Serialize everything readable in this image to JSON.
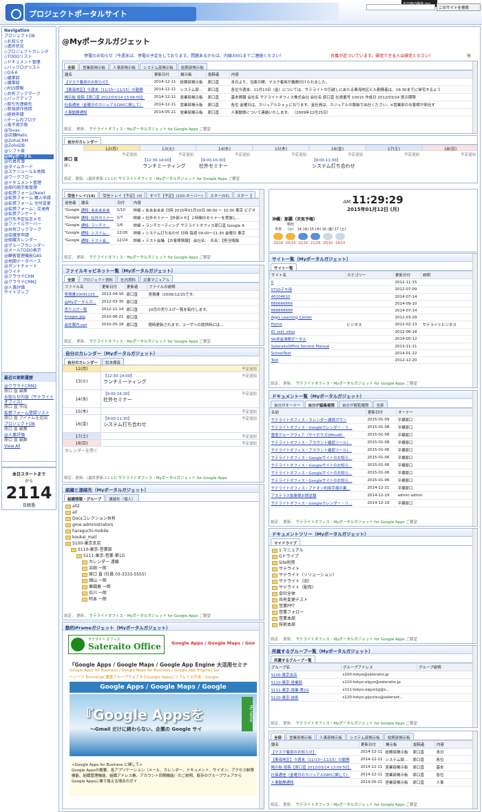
{
  "header": {
    "site_title": "プロジェクトポータルサイト",
    "topbar_label": "その他の操作 (m)",
    "search_button": "このサイトを検索"
  },
  "nav": {
    "title": "Navigation",
    "items": [
      "プロジェクトDB",
      "◇お知らせ",
      "◇進捗状況",
      "◇プロジェクトカレンダ",
      "◇TODOリスト",
      "◇ドキュメント管理",
      "◇バックログリスト",
      "◇Q＆A",
      "◇議事録",
      "◇議事録",
      "◇RSS情報",
      "◇共有ブックマーク",
      "◇バックアップ",
      "◇取引先連絡先",
      "◇新規部作他回",
      "◇経費申請",
      "◇チーム内ブログ",
      "◇電子掲示板",
      "@Tovas",
      "@店舗Matic",
      "@ZohoCRM",
      "@ZohoDB",
      "@シフト表",
      "@Myポータル",
      "@社員名簿",
      "@タイムカード",
      "@スケジュール＆地図",
      "@ワークフロー",
      "@ドキュメント管理",
      "@部内掲示板管理",
      "@拡張フォーム(New)",
      "@拡張フォーム 購入申請",
      "@拡張フォーム 住所変更",
      "@拡張フォーム：交通費",
      "@拡張アンケート",
      "@行先予定伝言メモ",
      "@ファイルサーバー",
      "@共有ブックマーク",
      "@会議室申請",
      "@組織カレンダー",
      "@グループカレンダー",
      "@メールTODO表示",
      "@顧客管理機能GAS",
      "@地図データベース",
      "@ガントチャート",
      "@ワイド",
      "@クラウドCRM",
      "@クラウドCRM2",
      "@人事評価",
      "サイトマップ"
    ],
    "active_index": 23
  },
  "recent": {
    "title": "最近の更新履歴",
    "items": [
      {
        "link": "@クラウドCRM2",
        "sub": "原口 直 編集"
      },
      {
        "link": "お知らせ内容（サテライトオフィス）",
        "sub": "原口 直 作成"
      },
      {
        "link": "拡張フォーム登録リスト",
        "sub": "原口 直 アイテムを追加"
      },
      {
        "link": "プロジェクトDB",
        "sub": "原口 直 編集"
      },
      {
        "link": "@人事評価",
        "sub": "原口 直 編集"
      }
    ],
    "view_all": "View All"
  },
  "counter": {
    "line1": "本日スタートまで",
    "line2": "から",
    "number": "2114",
    "unit": "日経過"
  },
  "page": {
    "title": "@Myポータルガジェット",
    "notice": "停電のお知らせ（今週末は、停電の予定をしております。問題あるかたは、内線3001までご連絡ください！",
    "notice_red": "台風が近づいています。帰宅できる人は帰宅ください！",
    "notice_green": "毎"
  },
  "footer": {
    "settings": "設定．",
    "more": "更新．",
    "brand": "サテライトオフィス・Myポータルガジェット for Google Apps",
    "feedback": "ご要望"
  },
  "board": {
    "tabs": [
      "全部",
      "営業部掲示板",
      "人事部掲示板",
      "システム部掲示板",
      "総務部掲示板"
    ],
    "cols": [
      "題名",
      "更新日付",
      "掲示板",
      "投稿者",
      "内容"
    ],
    "rows": [
      [
        "【マスク着用のお知らせ】",
        "2014-12-11",
        "総務部掲示板",
        "原口直",
        "本日より、当面の間、マスク着用が義務付けられました。"
      ],
      [
        "【東海地区】今週末（11/15～11/15）の勤務",
        "2014-12-11",
        "システム部...",
        "原口直",
        "各位今週末、11月13日（金）については、サテライトの引越しにあたる東海地区ビル勤務者は、19:30までに帰宅するよう"
      ],
      [
        "掲示板 投稿【原口直 2012/03/14 13:09:50】",
        "2014-12-11",
        "営業部掲示板",
        "原口直",
        "基本情報 会社名 サテライトオフィス株式会社 会社名 原口直 社員番号 10015 作成日 2012/03/14 提示期限"
      ],
      [
        "社長通信（金曜日のカジュアルDAYに関して）",
        "2014-12-11",
        "営業部掲示板",
        "原口直",
        "各位 金曜日は、カジュアルＤａｙになります。金社員は、カジュアルの服装で出社ください。※営業部のお客様が来社す"
      ],
      [
        "人事動静通知",
        "2014-05-21",
        "営業部掲示板",
        "原口直",
        "人事動態について連絡いたします。 （2009年12月25日）"
      ]
    ]
  },
  "calendar_week": {
    "title": "自分のカレンダー",
    "days": [
      "12(月)",
      "13(火)",
      "14(水)",
      "15(木)",
      "16(金)",
      "17(土)",
      "18(日)"
    ],
    "person": "原口 直",
    "add": "予定追加",
    "events": [
      {
        "day": 1,
        "time": "【12:30-14:00】",
        "name": "ランチミーティング"
      },
      {
        "day": 2,
        "time": "【9:00-16:30】",
        "name": "社外セミナー"
      },
      {
        "day": 4,
        "time": "【9:00-11:30】",
        "name": "システム打ち合わせ"
      }
    ],
    "close": "閉く",
    "footer": "設定．更新．(最終更新:11:13)"
  },
  "mail": {
    "tabs": [
      "受信トレイ(14)",
      "受信トレイ【予定】(4)",
      "すべて【予定】(100-オーバー)",
      "スター(55)",
      "スター【"
    ],
    "cols": [
      "送信者",
      "題名",
      "日付",
      "内容"
    ],
    "rows": [
      [
        "\"Google...",
        "通知: あああああ",
        "1/10",
        "詳細 » あああああ 日時 2015年01月10日 06:00 ～ 10:30 東京 ビデオ"
      ],
      [
        "\"Google...",
        "通知: 社外セミナー",
        "1/7",
        "詳細 » 社外セミナー【外部メモ】２時間のセミナーを実施し..."
      ],
      [
        "\"Google...",
        "通知: ランチミ...",
        "1/6",
        "詳細 » ランチミーティング サテライトオフィス原口直 Google A"
      ],
      [
        "\"Google...",
        "通知: システム...",
        "12/26",
        "詳細 » システム打ち合わせ 日時 毎週 09:00～11:30 金曜日 東京"
      ],
      [
        "\"Google...",
        "通知: テスト会...",
        "12/24",
        "詳細 » テスト会議 【お客様情報】 会社名：　氏名：【担当情報"
      ]
    ]
  },
  "clock": {
    "ampm": "AM",
    "time": "11:29:29",
    "date": "2015年01月12日 (月)",
    "weather_title": "沖縄：那覇（天気予報）",
    "forecast": [
      [
        "今日",
        "19|16"
      ],
      [
        "明日（火）",
        "20|14"
      ],
      [
        "14 (水)",
        "22|16"
      ],
      [
        "15 (木)",
        "21|18"
      ],
      [
        "16 (金)",
        "20|14"
      ],
      [
        "17 (土)",
        "19|14"
      ]
    ]
  },
  "filecab": {
    "title": "ファイルキャビネット一覧（Myポータルガジェット）",
    "tabs": [
      "全部",
      "プロジェクト資料",
      "社内資料",
      "災害マニュアル"
    ],
    "cols": [
      "ファイル名",
      "更新日付",
      "更新者",
      "ファイルの説明"
    ],
    "rows": [
      [
        "見積書20091225...",
        "2013-04-16",
        "原口直",
        "見積書（2009/12/25です。"
      ],
      [
        "@Myポータルガ...",
        "2012-03-30",
        "原口直",
        ""
      ],
      [
        "売り上げ一覧",
        "2012-11-14",
        "原口直",
        "10月の売り上げ一覧を転付します。"
      ],
      [
        "images.jpg",
        "2010-06-21",
        "原口直",
        ""
      ],
      [
        "会社案内.ppt",
        "2010-05-18",
        "原口直",
        "随時更新されます。ユーザへの提供時には..."
      ]
    ]
  },
  "sites": {
    "title": "サイト一覧（Myポータルガジェット）",
    "tab": "サイト一覧",
    "cols": [
      "サイト名",
      "カテゴリー",
      "更新日付",
      "説明"
    ],
    "rows": [
      [
        "0",
        "",
        "2012-11-15",
        ""
      ],
      [
        "0710デモ用",
        "",
        "2012-07-09",
        ""
      ],
      [
        "46104610",
        "",
        "2014-07-14",
        ""
      ],
      [
        "666666666",
        "",
        "2014-09-10",
        ""
      ],
      [
        "888888888",
        "",
        "2014-07-14",
        ""
      ],
      [
        "Apps Learning Center",
        "",
        "2012-03-29",
        ""
      ],
      [
        "Home",
        "ビジネス",
        "2012-02-13",
        "サテライトビジネス"
      ],
      [
        "ID_test_sites",
        "",
        "2012-06-18",
        ""
      ],
      [
        "SR求金清眼ポータル",
        "",
        "2014-05-12",
        ""
      ],
      [
        "SateraitoOffice Service Manual",
        "",
        "2013-11-11",
        ""
      ],
      [
        "SchoolTest",
        "",
        "2014-01-22",
        ""
      ],
      [
        "Test",
        "",
        "2012-12-20",
        ""
      ]
    ]
  },
  "calendar_day": {
    "title": "自分のカレンダー（Myポータルガジェット）",
    "tabs": [
      "自分のカレンダー",
      "松本課長"
    ],
    "days": [
      "12(月)",
      "13(火)",
      "14(水)",
      "15(木)",
      "16(金)",
      "17(土)",
      "18(日)"
    ],
    "events": [
      {
        "day": 1,
        "time": "【12:30-14:00】",
        "name": "ランチミーティング"
      },
      {
        "day": 2,
        "time": "【9:00-16:30】",
        "name": "社外セミナー"
      },
      {
        "day": 4,
        "time": "【9:00-11:30】",
        "name": "システム打ち合わせ"
      }
    ],
    "close": "カレンダーを閉く",
    "footer": "設定．更新．(最終更新:11:13)"
  },
  "docs": {
    "title": "ドキュメント一覧（Myポータルガジェット）",
    "tabs": [
      "自分がオーナー",
      "自分が編集権限",
      "自分が閲覧権限",
      "全部"
    ],
    "cols": [
      "名前",
      "更新日付",
      "オーナー"
    ],
    "rows": [
      [
        "サテライトオフィス・カレンダー連続ガウン",
        "2015-01-09",
        "平標原口"
      ],
      [
        "サテライトオフィス・Googleカレンダー・リ...",
        "2015-01-08",
        "平標原口"
      ],
      [
        "重度グループウェア（サイボウズOffice8）",
        "2015-01-08",
        "平標原口"
      ],
      [
        "サテライトオフィス・アカウント確認ツール(...",
        "2015-01-08",
        "平標原口"
      ],
      [
        "サテライトオフィス・アカウント確認ツール(...",
        "2015-01-06",
        "平標原口"
      ],
      [
        "サテライトオフィス・Googleサイトのお知ら...",
        "2015-01-06",
        "平標原口"
      ],
      [
        "サテライトオフィス・Googleサイトのお知ら...",
        "2015-01-06",
        "平標原口"
      ],
      [
        "サテライトオフィス・Googleサイトのお知ら...",
        "2015-01-06",
        "平標原口"
      ],
      [
        "サテライトオフィス・Googleサイトのお知ら...",
        "2015-01-06",
        "平標原口"
      ],
      [
        "サテライトオフィス・アドオン利用手順の書...",
        "2014-12-21",
        "平標原口"
      ],
      [
        "アステラス製薬様お問返報",
        "2014-12-19",
        "admin admin"
      ],
      [
        "サテライトオフィス・Googleカレンダー・リ...",
        "2014-12-19",
        "平標原口"
      ]
    ]
  },
  "org": {
    "title": "組織と連絡先（Myポータルガジェット）",
    "tabs": [
      "組織情報・グループ",
      "連絡先（個人）"
    ],
    "tree": [
      [
        0,
        "all2"
      ],
      [
        0,
        "all"
      ],
      [
        0,
        "Docsコレクション共有"
      ],
      [
        0,
        "gme-administrators"
      ],
      [
        0,
        "haraguchi-mobile"
      ],
      [
        0,
        "koukai_mail"
      ],
      [
        0,
        "S100-東京支店"
      ],
      [
        1,
        "S110-東京-営業部"
      ],
      [
        2,
        "S111-東京-営業-第1G"
      ],
      [
        3,
        "カレンダー 遠藤"
      ],
      [
        3,
        "浜田 一郎"
      ],
      [
        3,
        "原口 直 (社員 03-3333-5555)"
      ],
      [
        3,
        "畑山 一郎"
      ],
      [
        3,
        "東園恵 一郎"
      ],
      [
        3,
        "石川 一郎"
      ],
      [
        3,
        "阿本 一郎"
      ]
    ]
  },
  "doctree": {
    "title": "ドキュメントツリー（Myポータルガジェット）",
    "tab": "マイドライブ",
    "items": [
      "1.マニュアル",
      "Gドライブ",
      "Site利用",
      "サテライト",
      "サテライト（ソリューション）",
      "サテライト（旧）",
      "サテライト（配布）",
      "会社全体",
      "共有変更テスト",
      "営業PPT",
      "営業フォロー",
      "営業本部",
      "技術本部"
    ]
  },
  "iframe": {
    "title": "動的iFrameガジェット（Myポータルガジェット）",
    "logo": "Sateraito Office",
    "logo_sub": "サテライト オフィス",
    "nav_links": "Google Apps / Google Maps / Goo",
    "headline": "『Google Apps / Google Maps / Google App Engine 大活用セミナ",
    "sub1": "Google Apps for Business / Google Maps for Business / Google App Engine / Go",
    "sub2": "～ノーツ Exchange 重度グループウェアからGoogle Appsにリプレイス方法／Google",
    "banner_band": "Google Apps / Google Maps / Google",
    "banner_big": "『Google Appsを",
    "banner_small": "～Gmail だけに終わらない、企業の Google サイ",
    "twitter": "My twitter",
    "about_title": "<Google Apps for Business に関して>",
    "about_text": "Google Appsの概要、各アプリケーション（メール、カレンダー、ドキュメント、サイオン、アクセス制限機能、組織管理機能、組織アドレス帳、アカウント同期機能）のご説明、既存のグループウェアからGoogle Appsに乗り換える場合のポイ"
  },
  "groups": {
    "title": "所属するグループ一覧（Myポータルガジェット）",
    "tab": "所属するグループ一覧",
    "cols": [
      "グループ名",
      "グループアドレス",
      "グループ説明"
    ],
    "rows": [
      [
        "S100-東京支店",
        "s100-tokyo@sateraito.jp",
        ""
      ],
      [
        "S110-東京-営業部",
        "s110-tokyo-eigyo@sateraito.jp",
        ""
      ],
      [
        "S111-東京-営業-第1G",
        "s111-tokyo-eigyo1g@s...",
        ""
      ],
      [
        "S120-東京-技術",
        "s120-tokyo-gijyutsu@sateraot...",
        ""
      ]
    ]
  },
  "board2": {
    "tabs": [
      "全部",
      "営業部掲示板",
      "人事部掲示板",
      "システム部掲示板",
      "総務部掲示板"
    ],
    "cols": [
      "題名",
      "更新日付",
      "掲示板",
      "投稿者",
      "内容"
    ],
    "rows": [
      [
        "【マスク着用のお知らせ】",
        "2014-12-11",
        "総務部掲示板",
        "原口直",
        "本日"
      ],
      [
        "【東海地区】今週末（11/13～11/15）の勤務",
        "2014-12-11",
        "システム部...",
        "原口直",
        "各位"
      ],
      [
        "掲示板 投稿【原口直 2012/03/14 13:09:50】",
        "2014-12-11",
        "営業部掲示板",
        "原口直",
        "基本"
      ],
      [
        "社長通信（金曜日のカジュアルDAYに関して）",
        "2014-12-11",
        "営業部掲示板",
        "原口直",
        "各位"
      ],
      [
        "人事動静通知",
        "2014-05-21",
        "営業部掲示板",
        "原口直",
        "人事"
      ]
    ]
  }
}
